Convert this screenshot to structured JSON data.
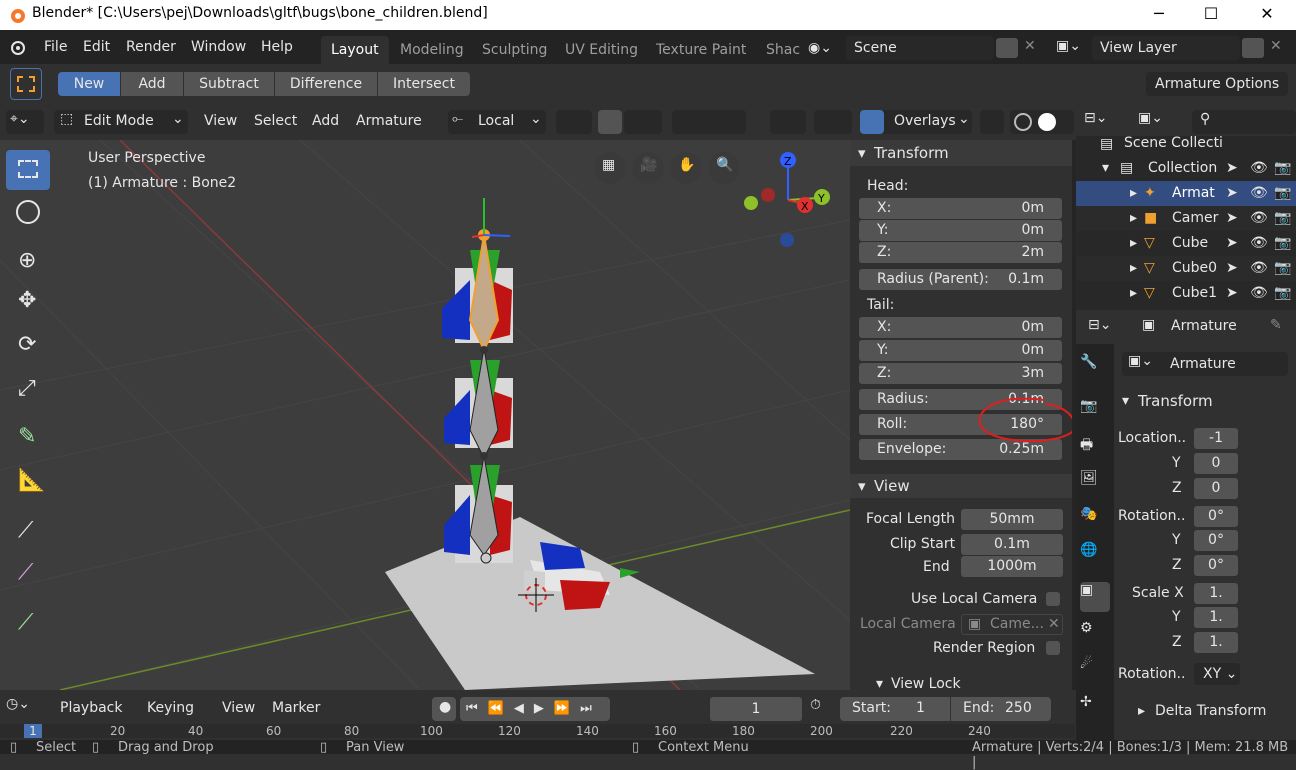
{
  "window": {
    "title": "Blender* [C:\\Users\\pej\\Downloads\\gltf\\bugs\\bone_children.blend]"
  },
  "menu": [
    "File",
    "Edit",
    "Render",
    "Window",
    "Help"
  ],
  "workspaces": [
    "Layout",
    "Modeling",
    "Sculpting",
    "UV Editing",
    "Texture Paint",
    "Shac"
  ],
  "scene": "Scene",
  "view_layer": "View Layer",
  "tool_header": {
    "modes": [
      "New",
      "Add",
      "Subtract",
      "Difference",
      "Intersect"
    ],
    "armature_options": "Armature Options"
  },
  "viewport_header": {
    "mode": "Edit Mode",
    "view": "View",
    "select": "Select",
    "add": "Add",
    "armature": "Armature",
    "orientation": "Local",
    "overlays": "Overlays"
  },
  "viewport": {
    "perspective": "User Perspective",
    "object": "(1) Armature : Bone2"
  },
  "transform": {
    "title": "Transform",
    "head": "Head:",
    "tail": "Tail:",
    "head_x_label": "X:",
    "head_x": "0m",
    "head_y_label": "Y:",
    "head_y": "0m",
    "head_z_label": "Z:",
    "head_z": "2m",
    "radius_parent_label": "Radius (Parent):",
    "radius_parent": "0.1m",
    "tail_x_label": "X:",
    "tail_x": "0m",
    "tail_y_label": "Y:",
    "tail_y": "0m",
    "tail_z_label": "Z:",
    "tail_z": "3m",
    "radius_label": "Radius:",
    "radius": "0.1m",
    "roll_label": "Roll:",
    "roll": "180°",
    "envelope_label": "Envelope:",
    "envelope": "0.25m"
  },
  "view_panel": {
    "title": "View",
    "focal_length_label": "Focal Length",
    "focal_length": "50mm",
    "clip_start_label": "Clip Start",
    "clip_start": "0.1m",
    "end_label": "End",
    "end": "1000m",
    "use_local_camera": "Use Local Camera",
    "local_camera_label": "Local Camera",
    "local_camera": "Came...",
    "render_region": "Render Region",
    "view_lock": "View Lock"
  },
  "outliner": {
    "rows": [
      {
        "name": "Scene Collecti"
      },
      {
        "name": "Collection"
      },
      {
        "name": "Armat"
      },
      {
        "name": "Camer"
      },
      {
        "name": "Cube"
      },
      {
        "name": "Cube0"
      },
      {
        "name": "Cube1"
      }
    ]
  },
  "properties": {
    "object_name": "Armature",
    "data_name": "Armature",
    "transform_title": "Transform",
    "location_label": "Location..",
    "loc_x": "-1",
    "loc_y_label": "Y",
    "loc_y": "0",
    "loc_z_label": "Z",
    "loc_z": "0",
    "rotation_label": "Rotation..",
    "rot_x": "0°",
    "rot_y_label": "Y",
    "rot_y": "0°",
    "rot_z_label": "Z",
    "rot_z": "0°",
    "scale_label": "Scale X",
    "scale_x": "1.",
    "scale_y_label": "Y",
    "scale_y": "1.",
    "scale_z_label": "Z",
    "scale_z": "1.",
    "rotation_mode_label": "Rotation..",
    "rotation_mode": "XY",
    "delta_transform": "Delta Transform"
  },
  "timeline": {
    "playback": "Playback",
    "keying": "Keying",
    "view": "View",
    "marker": "Marker",
    "current_frame": "1",
    "start_label": "Start:",
    "start": "1",
    "end_label": "End:",
    "end": "250",
    "ruler": [
      "1",
      "20",
      "40",
      "60",
      "80",
      "100",
      "120",
      "140",
      "160",
      "180",
      "200",
      "220",
      "240"
    ]
  },
  "status": {
    "select": "Select",
    "drag": "Drag and Drop",
    "pan": "Pan View",
    "context": "Context Menu",
    "info": "Armature | Verts:2/4 | Bones:1/3 | Mem: 21.8 MB |"
  },
  "colors": {
    "accent": "#4772b3",
    "active_orange": "#f0a030",
    "annotation_red": "#e01e1e",
    "panel": "#303030",
    "field": "#545454"
  }
}
